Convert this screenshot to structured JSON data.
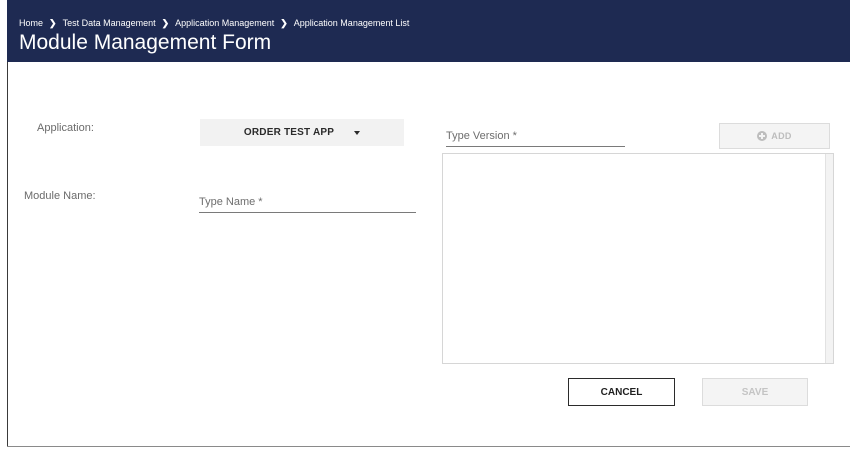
{
  "header": {
    "breadcrumb": [
      "Home",
      "Test Data Management",
      "Application Management",
      "Application Management List"
    ],
    "title": "Module Management Form",
    "background": "#1e2a52"
  },
  "form": {
    "application_label": "Application:",
    "application_value": "ORDER TEST APP",
    "module_name_label": "Module Name:",
    "module_name_placeholder": "Type Name *",
    "version_placeholder": "Type Version *",
    "add_label": "ADD",
    "cancel_label": "CANCEL",
    "save_label": "SAVE"
  },
  "icons": {
    "breadcrumb_separator": "chevron-right-icon",
    "dropdown_caret": "caret-down-icon",
    "add": "plus-circle-icon"
  }
}
